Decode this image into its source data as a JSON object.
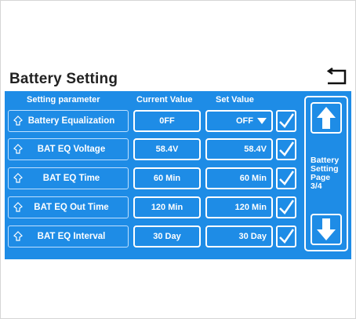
{
  "header": {
    "title": "Battery Setting"
  },
  "columns": {
    "param": "Setting parameter",
    "current": "Current Value",
    "set": "Set Value"
  },
  "rows": [
    {
      "name": "Battery Equalization",
      "current": "0FF",
      "set": "OFF",
      "has_dropdown": true
    },
    {
      "name": "BAT EQ Voltage",
      "current": "58.4V",
      "set": "58.4V"
    },
    {
      "name": "BAT EQ Time",
      "current": "60 Min",
      "set": "60 Min"
    },
    {
      "name": "BAT EQ Out Time",
      "current": "120 Min",
      "set": "120 Min"
    },
    {
      "name": "BAT EQ Interval",
      "current": "30 Day",
      "set": "30 Day"
    }
  ],
  "side": {
    "line1": "Battery",
    "line2": "Setting",
    "line3": "Page",
    "line4": "3/4"
  },
  "icons": {
    "back": "return-arrow-icon",
    "up": "arrow-up-icon",
    "down": "arrow-down-icon",
    "check": "checkmark-icon",
    "param": "lightbulb-icon",
    "dropdown": "triangle-down-icon"
  },
  "colors": {
    "panel": "#1e8ce6",
    "foreground": "#ffffff"
  }
}
